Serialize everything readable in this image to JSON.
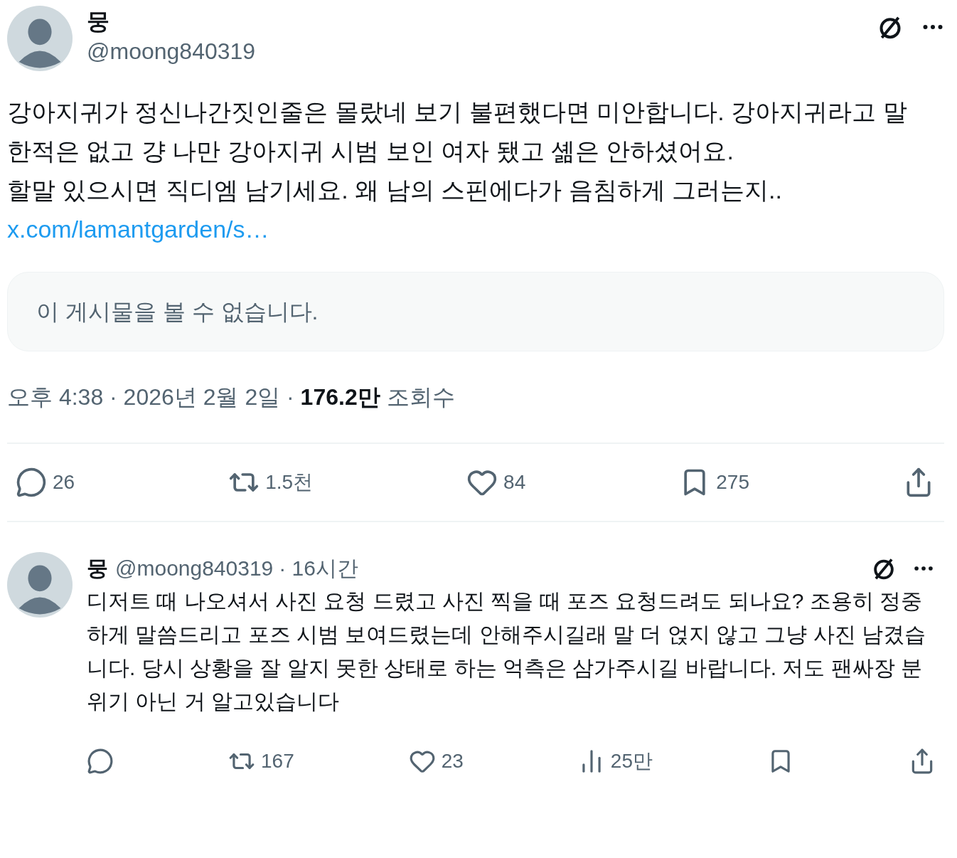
{
  "tweet": {
    "name": "뭉",
    "handle": "@moong840319",
    "paragraphs": [
      "강아지귀가 정신나간짓인줄은 몰랐네 보기 불편했다면 미안합니다. 강아지귀라고 말한적은 없고 걍 나만 강아지귀 시범 보인 여자 됐고 셺은 안하셨어요.",
      "할말 있으시면 직디엠 남기세요. 왜 남의 스핀에다가 음침하게 그러는지.."
    ],
    "link": "x.com/lamantgarden/s…",
    "quote_notice": "이 게시물을 볼 수 없습니다.",
    "meta": "오후 4:38 · 2026년 2월 2일 · **176.2만** 조회수",
    "actions": [
      {
        "kind": "reply",
        "count": "26"
      },
      {
        "kind": "repost",
        "count": "1.5천"
      },
      {
        "kind": "like",
        "count": "84"
      },
      {
        "kind": "bookmark",
        "count": "275"
      },
      {
        "kind": "share"
      }
    ]
  },
  "reply": {
    "name": "뭉",
    "handle": "@moong840319",
    "time": "· 16시간",
    "text": "디저트 때 나오셔서 사진 요청 드렸고 사진 찍을 때 포즈 요청드려도 되나요? 조용히 정중하게 말씀드리고 포즈 시범 보여드렸는데 안해주시길래 말 더 얹지 않고 그냥 사진 남겼습니다. 당시 상황을 잘 알지 못한 상태로 하는 억측은 삼가주시길 바랍니다. 저도 팬싸장 분위기 아닌 거 알고있습니다",
    "actions": [
      {
        "kind": "reply"
      },
      {
        "kind": "repost",
        "count": "167"
      },
      {
        "kind": "like",
        "count": "23"
      },
      {
        "kind": "views",
        "count": "25만"
      },
      {
        "kind": "bookmark"
      },
      {
        "kind": "share"
      }
    ]
  }
}
